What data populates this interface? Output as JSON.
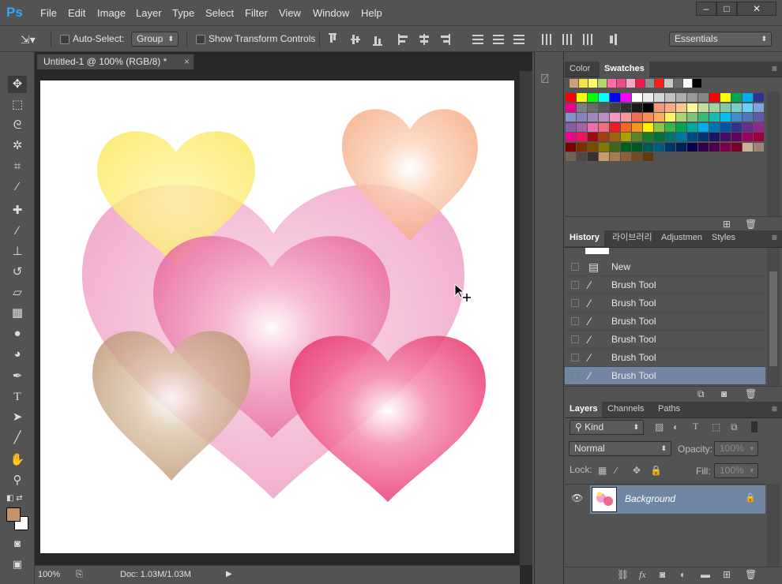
{
  "app": {
    "logo": "Ps",
    "window_controls": [
      "–",
      "□",
      "✕"
    ]
  },
  "menu": [
    "File",
    "Edit",
    "Image",
    "Layer",
    "Type",
    "Select",
    "Filter",
    "View",
    "Window",
    "Help"
  ],
  "options": {
    "auto_select_label": "Auto-Select:",
    "auto_select_value": "Group",
    "show_transform_label": "Show Transform Controls",
    "workspace": "Essentials"
  },
  "document": {
    "tab_title": "Untitled-1 @ 100% (RGB/8) *",
    "tab_close": "×",
    "zoom": "100%",
    "doc_info": "Doc: 1.03M/1.03M"
  },
  "tools": {
    "foreground_color": "#c4936b",
    "background_color": "#ffffff"
  },
  "swatches_panel": {
    "tabs": [
      "Color",
      "Swatches"
    ],
    "recent": [
      "#c9a27a",
      "#f5e142",
      "#ffff66",
      "#b2d36e",
      "#ff6ea8",
      "#e84d8a",
      "#f7a6c8",
      "#ee1c4c",
      "#8f8f8f",
      "#ff1c1c",
      "#c7c7c7",
      "#6a6a6a",
      "#ffffff",
      "#000000"
    ],
    "grid_rows": [
      [
        "#ff0000",
        "#ffff00",
        "#00ff00",
        "#00ffff",
        "#0000ff",
        "#ff00ff",
        "#ffffff",
        "#ebebeb",
        "#d6d6d6",
        "#c2c2c2",
        "#adadad",
        "#999999",
        "#858585",
        "#ff0000",
        "#ffff00",
        "#00a651",
        "#00aeef",
        "#2e3192"
      ],
      [
        "#ec008c",
        "#7f7f7f",
        "#6b6b6b",
        "#575757",
        "#424242",
        "#2e2e2e",
        "#1a1a1a",
        "#000000",
        "#f7977a",
        "#f9ad81",
        "#fdc68a",
        "#fff79a",
        "#c4df9b",
        "#a3d39c",
        "#82ca9d",
        "#7bcdc8",
        "#6ecff6",
        "#7ea7d8"
      ],
      [
        "#8493ca",
        "#8882be",
        "#a187be",
        "#bc8dbf",
        "#f49ac2",
        "#f6989d",
        "#f26c4f",
        "#f68e55",
        "#fbaf5c",
        "#fff467",
        "#acd372",
        "#7cc576",
        "#3bb878",
        "#1abbb4",
        "#00bff3",
        "#438cca",
        "#5574b9",
        "#605ca8"
      ],
      [
        "#855fa8",
        "#a763a8",
        "#f06ea9",
        "#f26d7d",
        "#ed1c24",
        "#f26522",
        "#f7941d",
        "#fff200",
        "#8dc73f",
        "#39b54a",
        "#00a651",
        "#00a99d",
        "#00aeef",
        "#0072bc",
        "#0054a6",
        "#2e3192",
        "#662d91",
        "#92278f"
      ],
      [
        "#ec008c",
        "#ed145b",
        "#9e0b0f",
        "#a0410d",
        "#a3620a",
        "#aba000",
        "#598527",
        "#1a7b30",
        "#007236",
        "#00746b",
        "#0076a3",
        "#004b80",
        "#003471",
        "#1b1464",
        "#440e62",
        "#630460",
        "#9e005d",
        "#9e0039"
      ],
      [
        "#790000",
        "#7b2e00",
        "#7d4900",
        "#827b00",
        "#406618",
        "#005e20",
        "#005826",
        "#005952",
        "#005b7f",
        "#003663",
        "#002157",
        "#0d004c",
        "#32004b",
        "#4b0049",
        "#7b0046",
        "#7a0026",
        "#c7b299",
        "#998675"
      ],
      [
        "#736357",
        "#534741",
        "#37302d",
        "#c69c6d",
        "#a67c52",
        "#8c6239",
        "#754c24",
        "#603913"
      ]
    ]
  },
  "history_panel": {
    "tabs": [
      "History",
      "라이브러리",
      "Adjustmen",
      "Styles"
    ],
    "items": [
      {
        "label": "New",
        "icon": "document-icon",
        "selected": false
      },
      {
        "label": "Brush Tool",
        "icon": "brush-icon",
        "selected": false
      },
      {
        "label": "Brush Tool",
        "icon": "brush-icon",
        "selected": false
      },
      {
        "label": "Brush Tool",
        "icon": "brush-icon",
        "selected": false
      },
      {
        "label": "Brush Tool",
        "icon": "brush-icon",
        "selected": false
      },
      {
        "label": "Brush Tool",
        "icon": "brush-icon",
        "selected": false
      },
      {
        "label": "Brush Tool",
        "icon": "brush-icon",
        "selected": true
      }
    ]
  },
  "layers_panel": {
    "tabs": [
      "Layers",
      "Channels",
      "Paths"
    ],
    "filter_value": "Kind",
    "blend_mode": "Normal",
    "opacity_label": "Opacity:",
    "opacity_value": "100%",
    "lock_label": "Lock:",
    "fill_label": "Fill:",
    "fill_value": "100%",
    "layers": [
      {
        "name": "Background",
        "visible": true,
        "locked": true
      }
    ]
  },
  "colors": {
    "accent": "#31a8ff",
    "selection": "#7086a3",
    "panel": "#535353",
    "canvas_bg": "#282828"
  }
}
